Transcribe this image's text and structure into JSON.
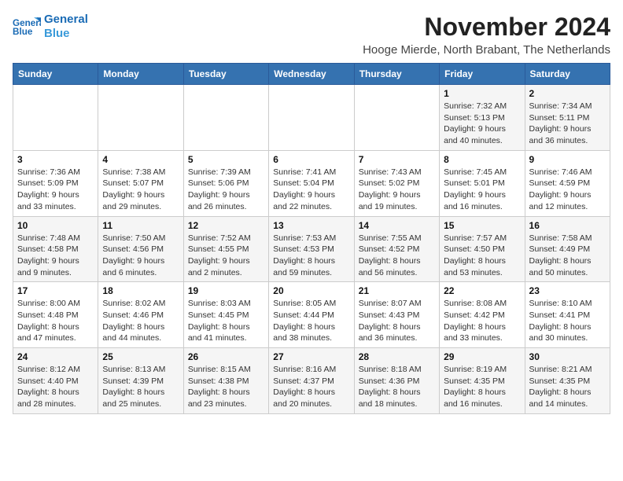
{
  "logo": {
    "text_general": "General",
    "text_blue": "Blue"
  },
  "header": {
    "month_title": "November 2024",
    "location": "Hooge Mierde, North Brabant, The Netherlands"
  },
  "columns": [
    "Sunday",
    "Monday",
    "Tuesday",
    "Wednesday",
    "Thursday",
    "Friday",
    "Saturday"
  ],
  "weeks": [
    [
      {
        "day": "",
        "info": ""
      },
      {
        "day": "",
        "info": ""
      },
      {
        "day": "",
        "info": ""
      },
      {
        "day": "",
        "info": ""
      },
      {
        "day": "",
        "info": ""
      },
      {
        "day": "1",
        "info": "Sunrise: 7:32 AM\nSunset: 5:13 PM\nDaylight: 9 hours and 40 minutes."
      },
      {
        "day": "2",
        "info": "Sunrise: 7:34 AM\nSunset: 5:11 PM\nDaylight: 9 hours and 36 minutes."
      }
    ],
    [
      {
        "day": "3",
        "info": "Sunrise: 7:36 AM\nSunset: 5:09 PM\nDaylight: 9 hours and 33 minutes."
      },
      {
        "day": "4",
        "info": "Sunrise: 7:38 AM\nSunset: 5:07 PM\nDaylight: 9 hours and 29 minutes."
      },
      {
        "day": "5",
        "info": "Sunrise: 7:39 AM\nSunset: 5:06 PM\nDaylight: 9 hours and 26 minutes."
      },
      {
        "day": "6",
        "info": "Sunrise: 7:41 AM\nSunset: 5:04 PM\nDaylight: 9 hours and 22 minutes."
      },
      {
        "day": "7",
        "info": "Sunrise: 7:43 AM\nSunset: 5:02 PM\nDaylight: 9 hours and 19 minutes."
      },
      {
        "day": "8",
        "info": "Sunrise: 7:45 AM\nSunset: 5:01 PM\nDaylight: 9 hours and 16 minutes."
      },
      {
        "day": "9",
        "info": "Sunrise: 7:46 AM\nSunset: 4:59 PM\nDaylight: 9 hours and 12 minutes."
      }
    ],
    [
      {
        "day": "10",
        "info": "Sunrise: 7:48 AM\nSunset: 4:58 PM\nDaylight: 9 hours and 9 minutes."
      },
      {
        "day": "11",
        "info": "Sunrise: 7:50 AM\nSunset: 4:56 PM\nDaylight: 9 hours and 6 minutes."
      },
      {
        "day": "12",
        "info": "Sunrise: 7:52 AM\nSunset: 4:55 PM\nDaylight: 9 hours and 2 minutes."
      },
      {
        "day": "13",
        "info": "Sunrise: 7:53 AM\nSunset: 4:53 PM\nDaylight: 8 hours and 59 minutes."
      },
      {
        "day": "14",
        "info": "Sunrise: 7:55 AM\nSunset: 4:52 PM\nDaylight: 8 hours and 56 minutes."
      },
      {
        "day": "15",
        "info": "Sunrise: 7:57 AM\nSunset: 4:50 PM\nDaylight: 8 hours and 53 minutes."
      },
      {
        "day": "16",
        "info": "Sunrise: 7:58 AM\nSunset: 4:49 PM\nDaylight: 8 hours and 50 minutes."
      }
    ],
    [
      {
        "day": "17",
        "info": "Sunrise: 8:00 AM\nSunset: 4:48 PM\nDaylight: 8 hours and 47 minutes."
      },
      {
        "day": "18",
        "info": "Sunrise: 8:02 AM\nSunset: 4:46 PM\nDaylight: 8 hours and 44 minutes."
      },
      {
        "day": "19",
        "info": "Sunrise: 8:03 AM\nSunset: 4:45 PM\nDaylight: 8 hours and 41 minutes."
      },
      {
        "day": "20",
        "info": "Sunrise: 8:05 AM\nSunset: 4:44 PM\nDaylight: 8 hours and 38 minutes."
      },
      {
        "day": "21",
        "info": "Sunrise: 8:07 AM\nSunset: 4:43 PM\nDaylight: 8 hours and 36 minutes."
      },
      {
        "day": "22",
        "info": "Sunrise: 8:08 AM\nSunset: 4:42 PM\nDaylight: 8 hours and 33 minutes."
      },
      {
        "day": "23",
        "info": "Sunrise: 8:10 AM\nSunset: 4:41 PM\nDaylight: 8 hours and 30 minutes."
      }
    ],
    [
      {
        "day": "24",
        "info": "Sunrise: 8:12 AM\nSunset: 4:40 PM\nDaylight: 8 hours and 28 minutes."
      },
      {
        "day": "25",
        "info": "Sunrise: 8:13 AM\nSunset: 4:39 PM\nDaylight: 8 hours and 25 minutes."
      },
      {
        "day": "26",
        "info": "Sunrise: 8:15 AM\nSunset: 4:38 PM\nDaylight: 8 hours and 23 minutes."
      },
      {
        "day": "27",
        "info": "Sunrise: 8:16 AM\nSunset: 4:37 PM\nDaylight: 8 hours and 20 minutes."
      },
      {
        "day": "28",
        "info": "Sunrise: 8:18 AM\nSunset: 4:36 PM\nDaylight: 8 hours and 18 minutes."
      },
      {
        "day": "29",
        "info": "Sunrise: 8:19 AM\nSunset: 4:35 PM\nDaylight: 8 hours and 16 minutes."
      },
      {
        "day": "30",
        "info": "Sunrise: 8:21 AM\nSunset: 4:35 PM\nDaylight: 8 hours and 14 minutes."
      }
    ]
  ]
}
